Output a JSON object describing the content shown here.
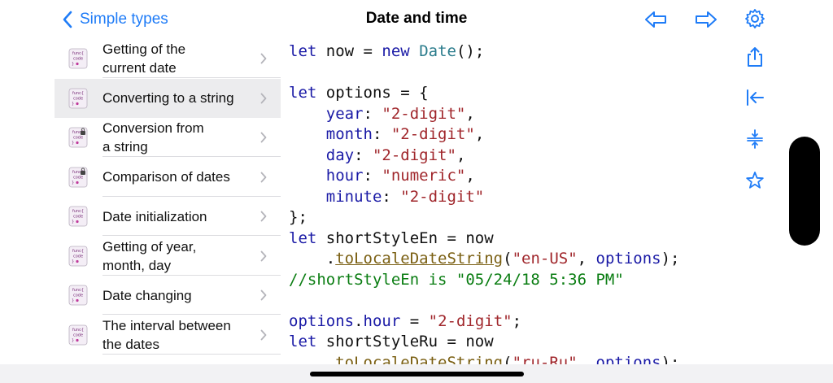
{
  "header": {
    "back_label": "Simple types",
    "title": "Date and time"
  },
  "sidebar": {
    "items": [
      {
        "lines": [
          "Getting of the",
          "current date"
        ],
        "locked": false,
        "selected": false
      },
      {
        "lines": [
          "Converting to a string"
        ],
        "locked": false,
        "selected": true
      },
      {
        "lines": [
          "Conversion from",
          "a string"
        ],
        "locked": true,
        "selected": false
      },
      {
        "lines": [
          "Comparison of dates"
        ],
        "locked": true,
        "selected": false
      },
      {
        "lines": [
          "Date initialization"
        ],
        "locked": false,
        "selected": false
      },
      {
        "lines": [
          "Getting of year,",
          "month, day"
        ],
        "locked": false,
        "selected": false
      },
      {
        "lines": [
          "Date changing"
        ],
        "locked": false,
        "selected": false
      },
      {
        "lines": [
          "The interval between",
          "the dates"
        ],
        "locked": false,
        "selected": false
      }
    ],
    "thumb_text": [
      "func{",
      "code",
      "}"
    ]
  },
  "code": {
    "lines": [
      [
        [
          "kw",
          "let"
        ],
        [
          "p",
          " now = "
        ],
        [
          "kw",
          "new"
        ],
        [
          "p",
          " "
        ],
        [
          "fn",
          "Date"
        ],
        [
          "p",
          "();"
        ]
      ],
      [],
      [
        [
          "kw",
          "let"
        ],
        [
          "p",
          " options = {"
        ]
      ],
      [
        [
          "p",
          "    "
        ],
        [
          "kw",
          "year"
        ],
        [
          "p",
          ": "
        ],
        [
          "str",
          "\"2-digit\""
        ],
        [
          "p",
          ","
        ]
      ],
      [
        [
          "p",
          "    "
        ],
        [
          "kw",
          "month"
        ],
        [
          "p",
          ": "
        ],
        [
          "str",
          "\"2-digit\""
        ],
        [
          "p",
          ","
        ]
      ],
      [
        [
          "p",
          "    "
        ],
        [
          "kw",
          "day"
        ],
        [
          "p",
          ": "
        ],
        [
          "str",
          "\"2-digit\""
        ],
        [
          "p",
          ","
        ]
      ],
      [
        [
          "p",
          "    "
        ],
        [
          "kw",
          "hour"
        ],
        [
          "p",
          ": "
        ],
        [
          "str",
          "\"numeric\""
        ],
        [
          "p",
          ","
        ]
      ],
      [
        [
          "p",
          "    "
        ],
        [
          "kw",
          "minute"
        ],
        [
          "p",
          ": "
        ],
        [
          "str",
          "\"2-digit\""
        ]
      ],
      [
        [
          "p",
          "};"
        ]
      ],
      [
        [
          "kw",
          "let"
        ],
        [
          "p",
          " shortStyleEn = now"
        ]
      ],
      [
        [
          "p",
          "    ."
        ],
        [
          "link",
          "toLocaleDateString"
        ],
        [
          "p",
          "("
        ],
        [
          "str",
          "\"en-US\""
        ],
        [
          "p",
          ", "
        ],
        [
          "kw",
          "options"
        ],
        [
          "p",
          ");"
        ]
      ],
      [
        [
          "cm",
          "//shortStyleEn is \"05/24/18 5:36 PM\""
        ]
      ],
      [],
      [
        [
          "kw",
          "options"
        ],
        [
          "p",
          "."
        ],
        [
          "kw",
          "hour"
        ],
        [
          "p",
          " = "
        ],
        [
          "str",
          "\"2-digit\""
        ],
        [
          "p",
          ";"
        ]
      ],
      [
        [
          "kw",
          "let"
        ],
        [
          "p",
          " shortStyleRu = now"
        ]
      ],
      [
        [
          "p",
          "    ."
        ],
        [
          "link",
          "toLocaleDateString"
        ],
        [
          "p",
          "("
        ],
        [
          "str",
          "\"ru-Ru\""
        ],
        [
          "p",
          ", "
        ],
        [
          "kw",
          "options"
        ],
        [
          "p",
          ");"
        ]
      ]
    ]
  },
  "toolbar": {
    "icons": [
      "back-arrow-icon",
      "forward-arrow-icon",
      "gear-icon",
      "share-icon",
      "collapse-left-icon",
      "fold-vertical-icon",
      "star-icon"
    ]
  },
  "colors": {
    "accent": "#1f7cf7",
    "keyword": "#1a1aa6",
    "string": "#a0262b",
    "comment": "#0a7d12",
    "type": "#2b7c8c",
    "link": "#7a5f12"
  }
}
